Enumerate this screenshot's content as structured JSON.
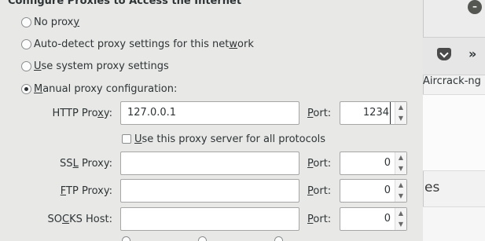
{
  "dialog": {
    "section_title": "Configure Proxies to Access the Internet",
    "options": {
      "no_proxy": {
        "pre": "No prox",
        "acc": "y",
        "post": ""
      },
      "auto_detect": {
        "pre": "Auto-detect proxy settings for this net",
        "acc": "w",
        "post": "ork"
      },
      "system": {
        "pre": "",
        "acc": "U",
        "post": "se system proxy settings"
      },
      "manual": {
        "pre": "",
        "acc": "M",
        "post": "anual proxy configuration:"
      }
    },
    "selected_option": "manual",
    "http": {
      "label_pre": "HTTP Pro",
      "label_acc": "x",
      "label_post": "y:",
      "value": "127.0.0.1",
      "port_label_acc": "P",
      "port_label_post": "ort:",
      "port": "1234"
    },
    "use_for_all": {
      "pre": "",
      "acc": "U",
      "post": "se this proxy server for all protocols",
      "checked": false
    },
    "ssl": {
      "label_pre": "SS",
      "label_acc": "L",
      "label_post": " Proxy:",
      "value": "",
      "port_label_acc": "P",
      "port_label_post": "ort:",
      "port": "0"
    },
    "ftp": {
      "label_pre": "",
      "label_acc": "F",
      "label_post": "TP Proxy:",
      "value": "",
      "port_label_acc": "P",
      "port_label_post": "ort:",
      "port": "0"
    },
    "socks": {
      "label_pre": "SO",
      "label_acc": "C",
      "label_post": "KS Host:",
      "value": "",
      "port_label_acc": "P",
      "port_label_post": "ort:",
      "port": "0"
    }
  },
  "background_window": {
    "tab_label": "Aircrack-ng",
    "partial_text": "es",
    "icons": [
      "close-icon",
      "pocket-icon",
      "overflow-chevron-icon"
    ]
  },
  "colors": {
    "dialog_bg": "#e8e8e7",
    "input_bg": "#ffffff",
    "text": "#2e3436"
  }
}
